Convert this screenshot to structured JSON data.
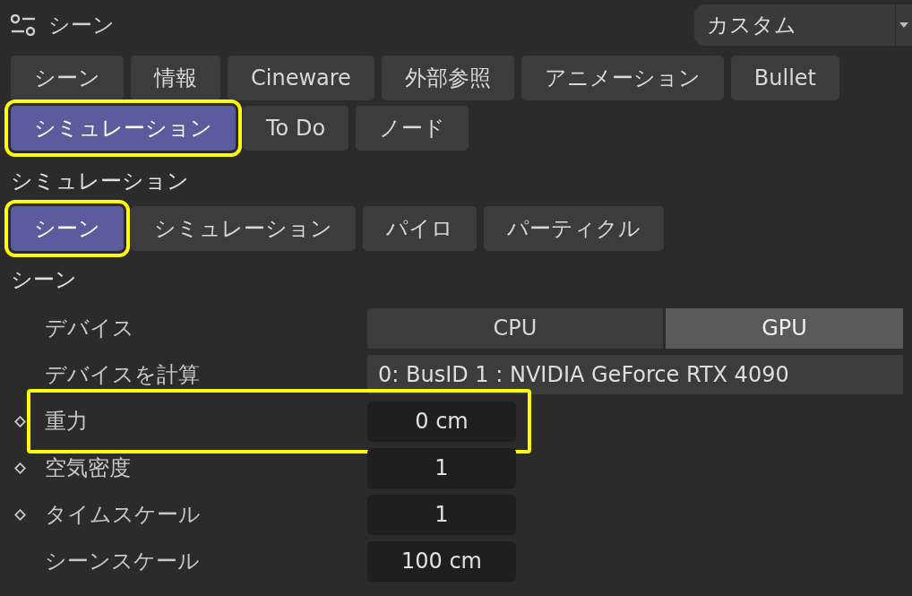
{
  "header": {
    "title": "シーン",
    "preset": "カスタム"
  },
  "tab_rows": [
    [
      {
        "label": "シーン",
        "selected": false,
        "highlighted": false
      },
      {
        "label": "情報",
        "selected": false,
        "highlighted": false
      },
      {
        "label": "Cineware",
        "selected": false,
        "highlighted": false
      },
      {
        "label": "外部参照",
        "selected": false,
        "highlighted": false
      },
      {
        "label": "アニメーション",
        "selected": false,
        "highlighted": false
      },
      {
        "label": "Bullet",
        "selected": false,
        "highlighted": false
      }
    ],
    [
      {
        "label": "シミュレーション",
        "selected": true,
        "highlighted": true
      },
      {
        "label": "To Do",
        "selected": false,
        "highlighted": false
      },
      {
        "label": "ノード",
        "selected": false,
        "highlighted": false
      }
    ]
  ],
  "section_title": "シミュレーション",
  "subtabs": [
    {
      "label": "シーン",
      "selected": true,
      "highlighted": true
    },
    {
      "label": "シミュレーション",
      "selected": false,
      "highlighted": false
    },
    {
      "label": "パイロ",
      "selected": false,
      "highlighted": false
    },
    {
      "label": "パーティクル",
      "selected": false,
      "highlighted": false
    }
  ],
  "group_title": "シーン",
  "params": [
    {
      "kind": "segmented",
      "label": "デバイス",
      "keyframe": false,
      "highlighted": false,
      "options": [
        {
          "label": "CPU",
          "selected": false
        },
        {
          "label": "GPU",
          "selected": true
        }
      ]
    },
    {
      "kind": "wide",
      "label": "デバイスを計算",
      "keyframe": false,
      "highlighted": false,
      "value": "0: BusID 1 : NVIDIA GeForce RTX 4090"
    },
    {
      "kind": "number",
      "label": "重力",
      "keyframe": true,
      "highlighted": true,
      "value": "0 cm"
    },
    {
      "kind": "number",
      "label": "空気密度",
      "keyframe": true,
      "highlighted": false,
      "value": "1"
    },
    {
      "kind": "number",
      "label": "タイムスケール",
      "keyframe": true,
      "highlighted": false,
      "value": "1"
    },
    {
      "kind": "number",
      "label": "シーンスケール",
      "keyframe": false,
      "highlighted": false,
      "value": "100 cm"
    }
  ]
}
